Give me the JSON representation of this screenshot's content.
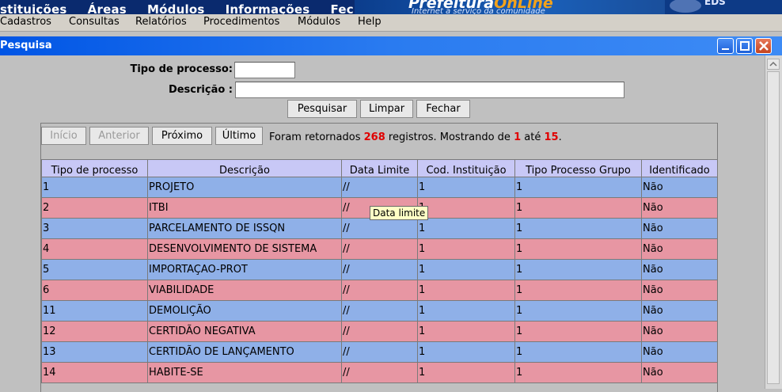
{
  "banner": {
    "menu": [
      "stituições",
      "Áreas",
      "Módulos",
      "Informações",
      "Fechar"
    ],
    "brand_prefix": "Prefeitura",
    "brand_suffix": "OnLine",
    "tagline": "Internet a serviço da comunidade",
    "logo_text": "EDS"
  },
  "menubar": [
    "Cadastros",
    "Consultas",
    "Relatórios",
    "Procedimentos",
    "Módulos",
    "Help"
  ],
  "window": {
    "title": "Pesquisa"
  },
  "form": {
    "tipo_label": "Tipo de processo:",
    "tipo_value": "",
    "desc_label": "Descrição :",
    "desc_value": "",
    "buttons": {
      "search": "Pesquisar",
      "clear": "Limpar",
      "close": "Fechar"
    }
  },
  "pager": {
    "first": "Início",
    "prev": "Anterior",
    "next": "Próximo",
    "last": "Último",
    "info_prefix": "Foram retornados",
    "total": "268",
    "info_mid": "registros. Mostrando de",
    "from": "1",
    "info_to": "até",
    "to": "15",
    "info_end": "."
  },
  "table": {
    "columns": [
      "Tipo de processo",
      "Descrição",
      "Data Limite",
      "Cod. Instituição",
      "Tipo Processo Grupo",
      "Identificado"
    ],
    "rows": [
      {
        "tipo": "1",
        "descricao": "PROJETO",
        "data": "//",
        "cod": "1",
        "grupo": "1",
        "ident": "Não"
      },
      {
        "tipo": "2",
        "descricao": "ITBI",
        "data": "//",
        "cod": "1",
        "grupo": "1",
        "ident": "Não"
      },
      {
        "tipo": "3",
        "descricao": "PARCELAMENTO DE ISSQN",
        "data": "//",
        "cod": "1",
        "grupo": "1",
        "ident": "Não"
      },
      {
        "tipo": "4",
        "descricao": "DESENVOLVIMENTO DE SISTEMA",
        "data": "//",
        "cod": "1",
        "grupo": "1",
        "ident": "Não"
      },
      {
        "tipo": "5",
        "descricao": "IMPORTAÇAO-PROT",
        "data": "//",
        "cod": "1",
        "grupo": "1",
        "ident": "Não"
      },
      {
        "tipo": "6",
        "descricao": "VIABILIDADE",
        "data": "//",
        "cod": "1",
        "grupo": "1",
        "ident": "Não"
      },
      {
        "tipo": "11",
        "descricao": "DEMOLIÇÃO",
        "data": "//",
        "cod": "1",
        "grupo": "1",
        "ident": "Não"
      },
      {
        "tipo": "12",
        "descricao": "CERTIDÃO NEGATIVA",
        "data": "//",
        "cod": "1",
        "grupo": "1",
        "ident": "Não"
      },
      {
        "tipo": "13",
        "descricao": "CERTIDÃO DE LANÇAMENTO",
        "data": "//",
        "cod": "1",
        "grupo": "1",
        "ident": "Não"
      },
      {
        "tipo": "14",
        "descricao": "HABITE-SE",
        "data": "//",
        "cod": "1",
        "grupo": "1",
        "ident": "Não"
      }
    ]
  },
  "tooltip": "Data limite",
  "colors": {
    "row_blue": "#8fb0e8",
    "row_pink": "#e796a3",
    "header": "#c8c8f6",
    "titlebar": "#0055e5",
    "highlight": "#e00000"
  }
}
